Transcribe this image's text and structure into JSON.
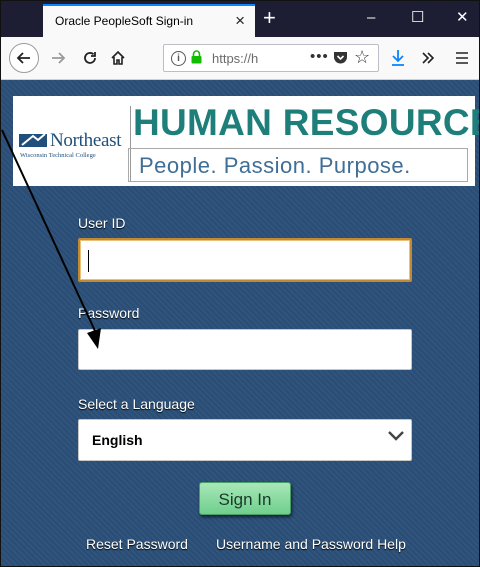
{
  "browser": {
    "tab_title": "Oracle PeopleSoft Sign-in",
    "tab_close": "×",
    "new_tab": "+",
    "url_text": "https://h",
    "url_dots": "•••",
    "window_controls": {
      "minimize": "–",
      "maximize": "☐",
      "close": "✕"
    }
  },
  "banner": {
    "logo_name": "Northeast",
    "logo_sub": "Wisconsin Technical College",
    "title": "HUMAN RESOURCES",
    "tagline": "People. Passion. Purpose."
  },
  "form": {
    "user_id_label": "User ID",
    "user_id_value": "",
    "password_label": "Password",
    "password_value": "",
    "language_label": "Select a Language",
    "language_value": "English",
    "signin_label": "Sign In"
  },
  "links": {
    "reset_password": "Reset Password",
    "username_help": "Username and Password Help"
  },
  "colors": {
    "page_bg": "#2a4f78",
    "title_teal": "#1e7f7a",
    "signin_green": "#6fcf8d",
    "focus_border": "#c28a30"
  }
}
